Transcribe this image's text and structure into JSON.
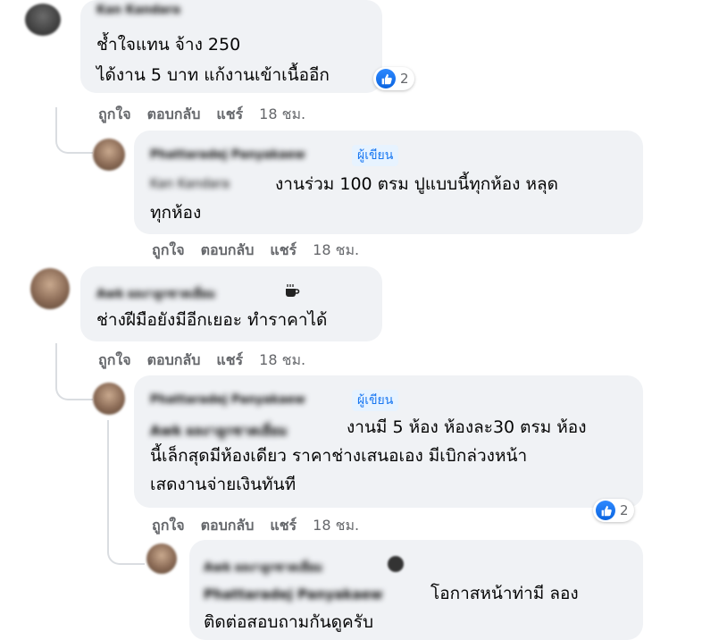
{
  "comments": [
    {
      "name": "Kan Kandara",
      "lines": [
        "ช้ำใจแทน จ้าง 250",
        "ได้งาน 5 บาท แก้งานเข้าเนื้ออีก"
      ],
      "reactions": "2"
    },
    {
      "name": "Phattaradej Panyakaew",
      "badge": "ผู้เขียน",
      "mention": "Kan Kandara",
      "line1": "งานร่วม 100 ตรม ปูแบบนี้ทุกห้อง หลุด",
      "line2": "ทุกห้อง"
    },
    {
      "name": "Awk ผลงาลูกชาตเยี่ยม",
      "lines": [
        "ช่างฝีมือยังมีอีกเยอะ ทำราคาได้"
      ]
    },
    {
      "name": "Phattaradej Panyakaew",
      "badge": "ผู้เขียน",
      "mention": "Awk ผลงาลูกชาตเยี่ยม",
      "line1": "งานมี 5 ห้อง ห้องละ30 ตรม ห้อง",
      "line2": "นี้เล็กสุดมีห้องเดียว ราคาช่างเสนอเอง มีเบิกล่วงหน้า",
      "line3": "เสดงานจ่ายเงินทันที",
      "reactions": "2"
    },
    {
      "name": "Awk ผลงาลูกชาตเยี่ยม",
      "mention": "Phattaradej Panyakaew",
      "line1": "โอกาสหน้าท่ามี ลอง",
      "line2": "ติดต่อสอบถามกันดูครับ"
    }
  ],
  "actions": {
    "like": "ถูกใจ",
    "reply": "ตอบกลับ",
    "share": "แชร์",
    "time": "18 ชม."
  },
  "icons": {
    "like": "thumbs-up-icon",
    "coffee": "coffee-icon"
  }
}
